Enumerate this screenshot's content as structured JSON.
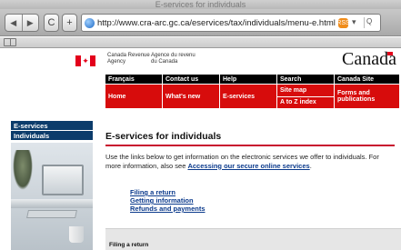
{
  "browser": {
    "window_title": "E-services for individuals",
    "url": "http://www.cra-arc.gc.ca/eservices/tax/individuals/menu-e.html",
    "search_text": "Q",
    "back_label": "◀",
    "forward_label": "▶",
    "reload_label": "C",
    "add_label": "+",
    "rss_label": "RSS",
    "go_label": "▾"
  },
  "header": {
    "agency_en": "Canada Revenue\nAgency",
    "agency_fr": "Agence du revenu\ndu Canada",
    "wordmark": "Canada"
  },
  "menu": {
    "francais": "Français",
    "contact": "Contact us",
    "help": "Help",
    "search": "Search",
    "canada_site": "Canada Site",
    "home": "Home",
    "whats_new": "What's new",
    "eservices": "E-services",
    "site_map": "Site map",
    "a_to_z": "A to Z index",
    "forms": "Forms and publications"
  },
  "sidebar": {
    "items": [
      "E-services",
      "Individuals"
    ]
  },
  "main": {
    "title": "E-services for individuals",
    "intro_text": "Use the links below to get information on the electronic services we offer to individuals. For more information, also see ",
    "intro_link": "Accessing our secure online services",
    "intro_end": ".",
    "links": [
      "Filing a return",
      "Getting information",
      "Refunds and payments"
    ],
    "section_label": "Filing a return"
  }
}
